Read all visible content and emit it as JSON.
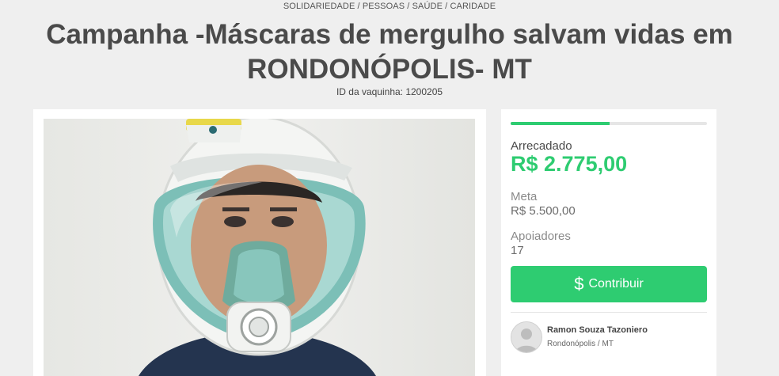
{
  "header": {
    "categories": "SOLIDARIEDADE / PESSOAS / SAÚDE / CARIDADE",
    "title": "Campanha -Máscaras de mergulho salvam vidas em RONDONÓPOLIS- MT",
    "vaquinha_id": "ID da vaquinha: 1200205"
  },
  "media": {
    "image_alt": "man-wearing-full-face-snorkel-mask"
  },
  "stats": {
    "progress_fraction": 0.5045,
    "raised_label": "Arrecadado",
    "raised_value": "R$ 2.775,00",
    "goal_label": "Meta",
    "goal_value": "R$ 5.500,00",
    "supporters_label": "Apoiadores",
    "supporters_value": "17"
  },
  "actions": {
    "contribute_icon": "$",
    "contribute_label": "Contribuir"
  },
  "owner": {
    "name": "Ramon Souza Tazoniero",
    "location": "Rondonópolis / MT"
  },
  "colors": {
    "accent": "#2ecc71",
    "background": "#efefef"
  }
}
